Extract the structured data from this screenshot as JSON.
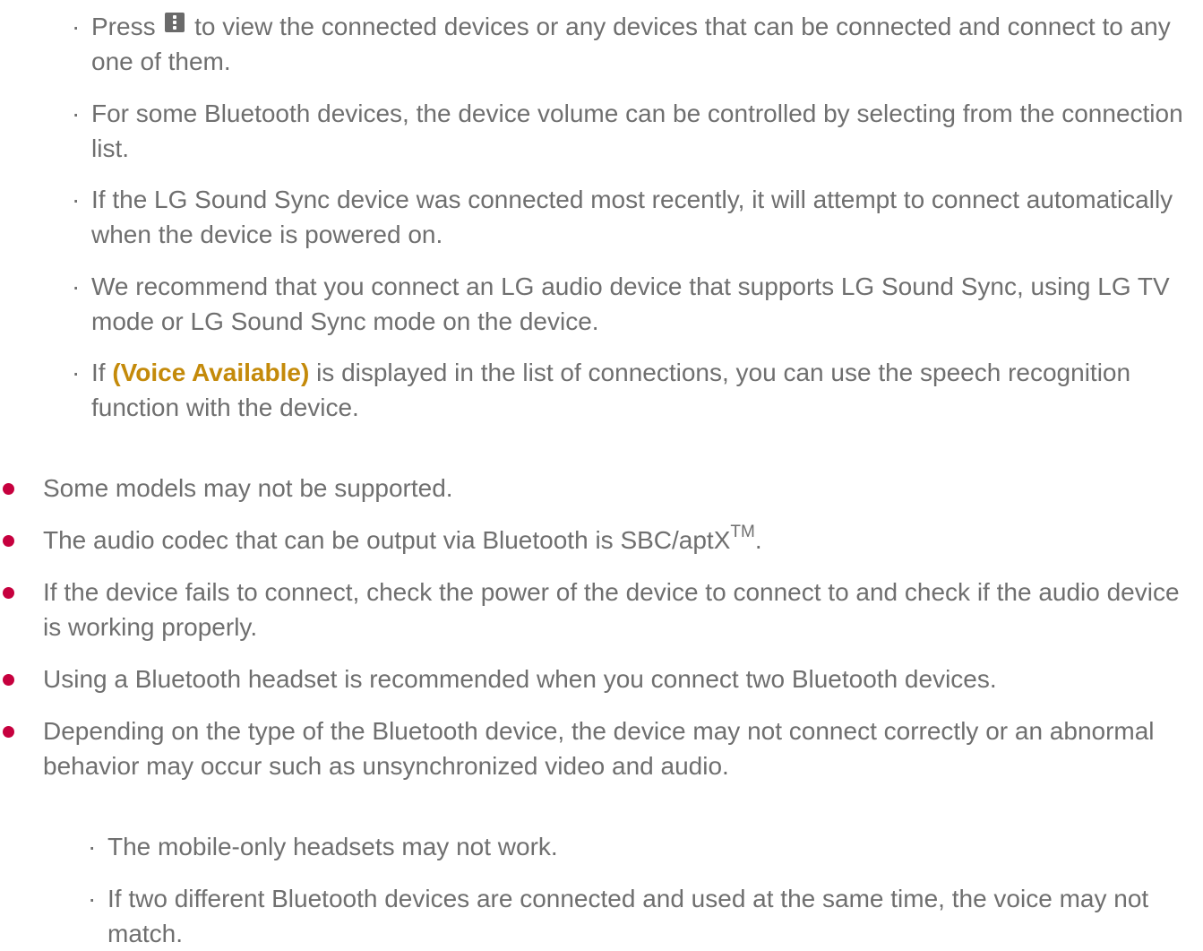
{
  "sub_items_top": [
    {
      "before": "Press",
      "icon": "more-menu-icon",
      "after": "to view the connected devices or any devices that can be connected and connect to any one of them."
    },
    {
      "text": "For some Bluetooth devices, the device volume can be controlled by selecting from the connection list."
    },
    {
      "text": "If the LG Sound Sync device was connected most recently, it will attempt to connect automatically when the device is powered on."
    },
    {
      "text": "We recommend that you connect an LG audio device that supports LG Sound Sync, using LG TV mode or LG Sound Sync mode on the device."
    },
    {
      "before": "If",
      "highlight": "(Voice Available)",
      "after": "is displayed in the list of connections, you can use the speech recognition function with the device."
    }
  ],
  "notes": [
    {
      "text": "Some models may not be supported."
    },
    {
      "before": "The audio codec that can be output via Bluetooth is SBC/aptX",
      "sup": "TM",
      "after": "."
    },
    {
      "text": "If the device fails to connect, check the power of the device to connect to and check if the audio device is working properly."
    },
    {
      "text": "Using a Bluetooth headset is recommended when you connect two Bluetooth devices."
    },
    {
      "text": "Depending on the type of the Bluetooth device, the device may not connect correctly or an abnormal behavior may occur such as unsynchronized video and audio."
    }
  ],
  "sub_items_bottom": [
    {
      "text": "The mobile-only headsets may not work."
    },
    {
      "text": "If two different Bluetooth devices are connected and used at the same time, the voice may not match."
    }
  ],
  "colors": {
    "text": "#6f6f6f",
    "bullet": "#c6003e",
    "highlight": "#c48a0a",
    "icon": "#6a6a6a"
  }
}
